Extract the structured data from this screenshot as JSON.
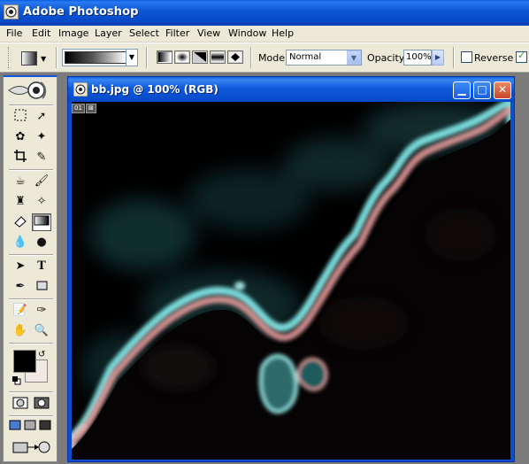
{
  "app": {
    "title": "Adobe Photoshop",
    "icon": "photoshop-eye-icon"
  },
  "menu": {
    "items": [
      "File",
      "Edit",
      "Image",
      "Layer",
      "Select",
      "Filter",
      "View",
      "Window",
      "Help"
    ]
  },
  "options": {
    "mode_label": "Mode:",
    "mode_value": "Normal",
    "opacity_label": "Opacity:",
    "opacity_value": "100%",
    "reverse_label": "Reverse",
    "reverse_checked": false,
    "dither_checked": true,
    "gradient_types": [
      "linear-gradient-icon",
      "radial-gradient-icon",
      "angle-gradient-icon",
      "reflected-gradient-icon",
      "diamond-gradient-icon"
    ],
    "active_gradient_type": 0
  },
  "toolbox": {
    "active_tool": "gradient-tool",
    "foreground_color": "#000000",
    "background_color": "#f1e7e3"
  },
  "document": {
    "title": "bb.jpg @ 100% (RGB)",
    "badges": [
      "01",
      "⊠"
    ],
    "buttons": [
      "▁",
      "□",
      "✕"
    ]
  },
  "colors": {
    "titlebar": "#0548c6",
    "chrome": "#ece9d8",
    "cloud_glow_cyan": "#8fe0e0",
    "cloud_glow_pink": "#e3a0a0"
  }
}
